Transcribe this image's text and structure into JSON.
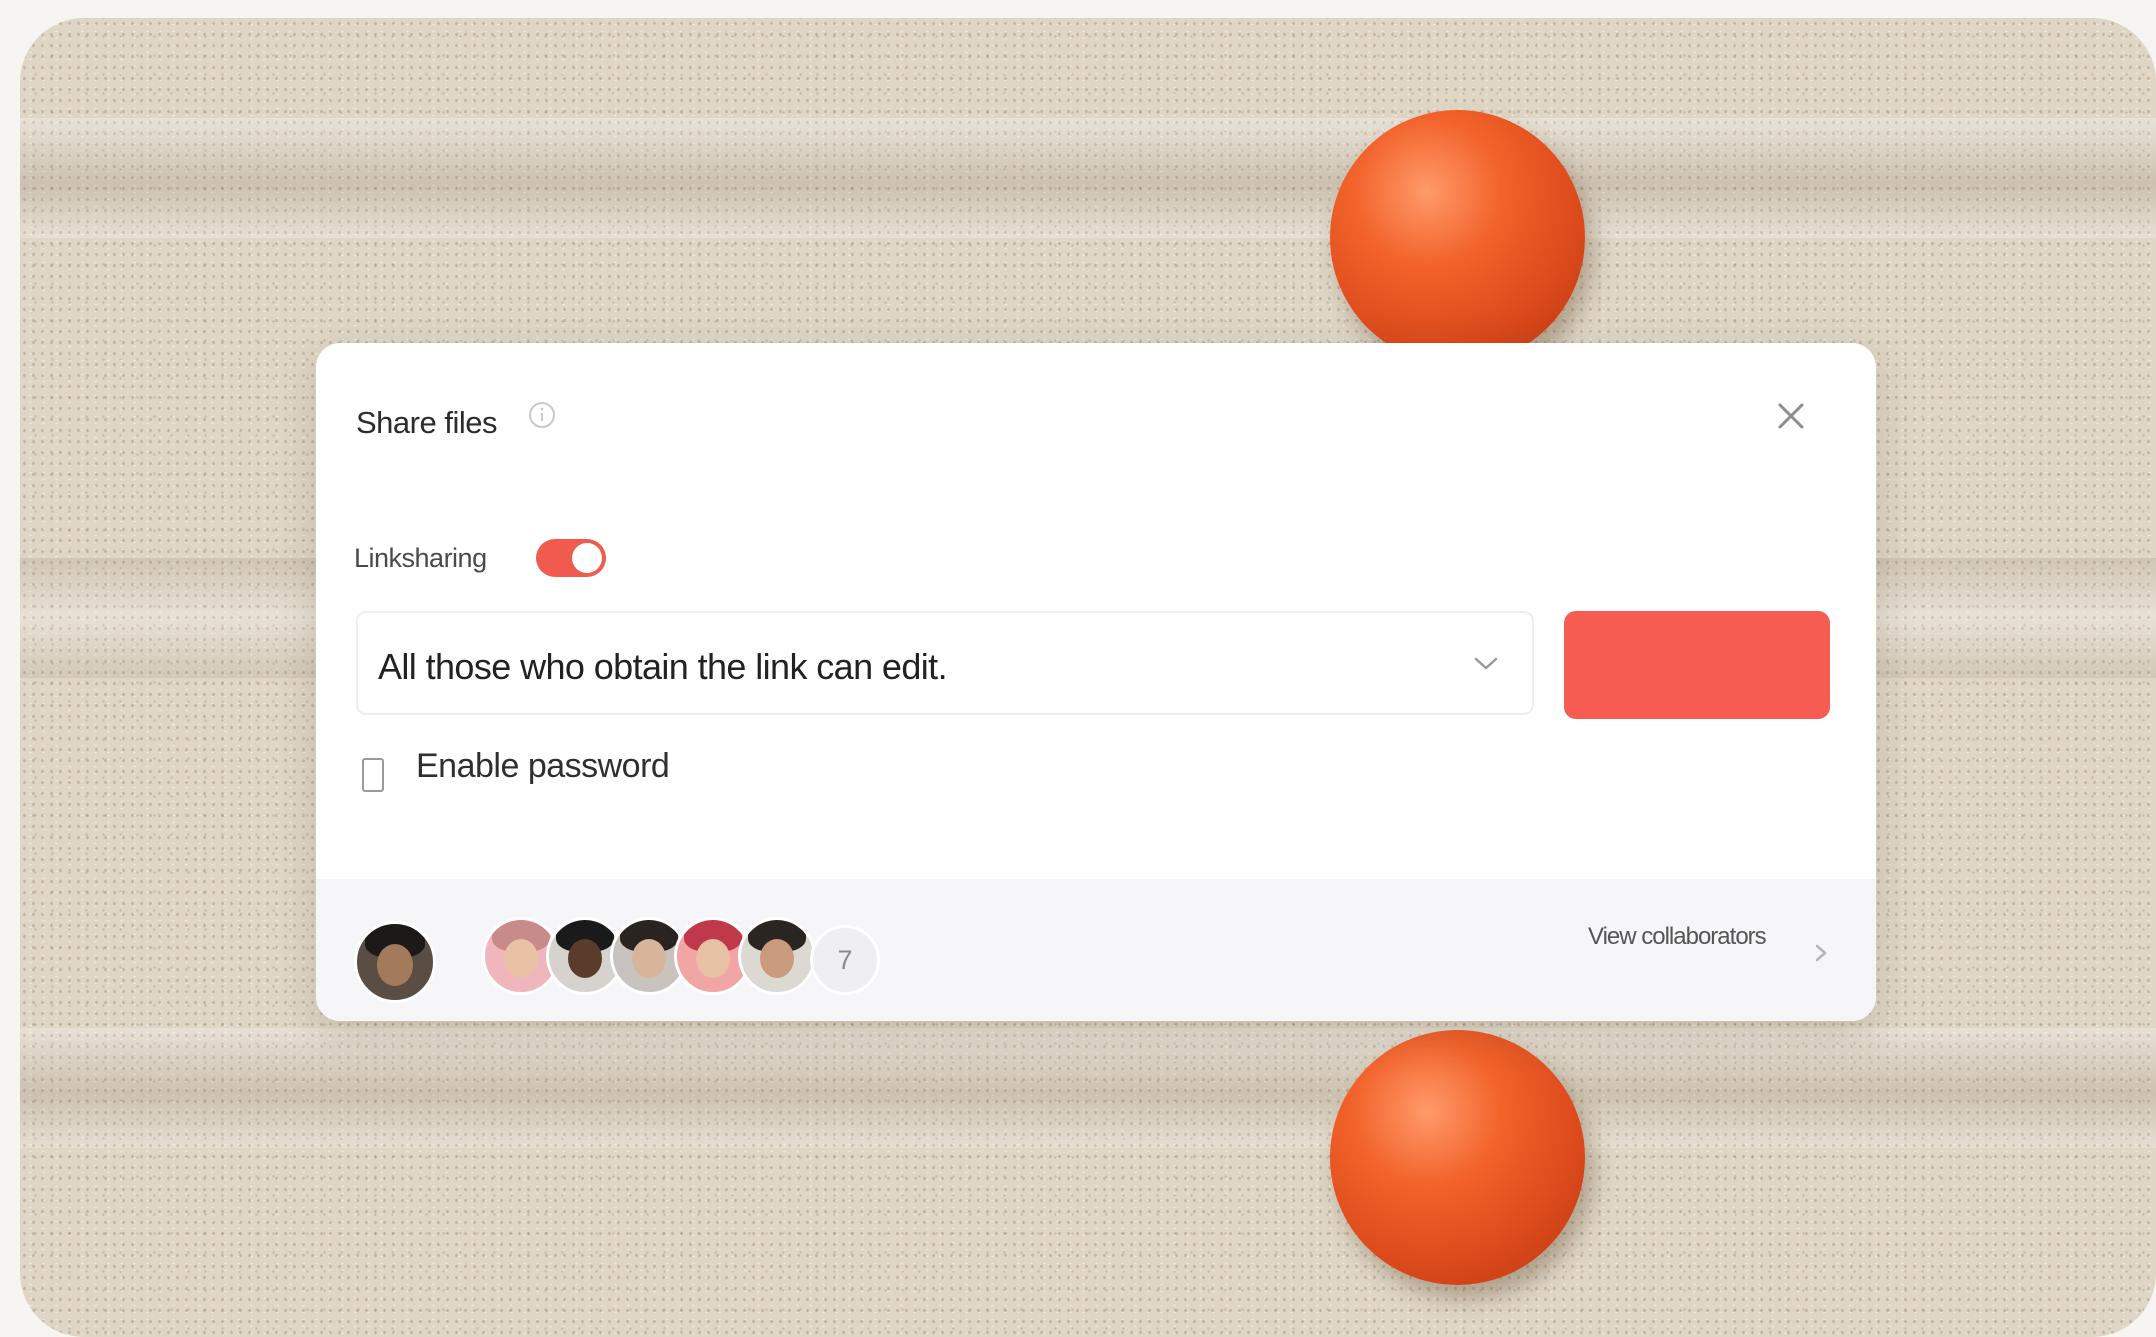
{
  "dialog": {
    "title": "Share files",
    "close_icon": "close-icon",
    "info_icon": "info-icon"
  },
  "link_sharing": {
    "label": "Linksharing",
    "enabled": true
  },
  "permission": {
    "selected": "All those who obtain the link can edit."
  },
  "password": {
    "label": "Enable password",
    "checked": false
  },
  "collaborators": {
    "extra_count": "7",
    "view_label": "View collaborators"
  },
  "colors": {
    "accent": "#f75c52",
    "toggle_on": "#f05a4f",
    "ball": "#e8531f"
  }
}
